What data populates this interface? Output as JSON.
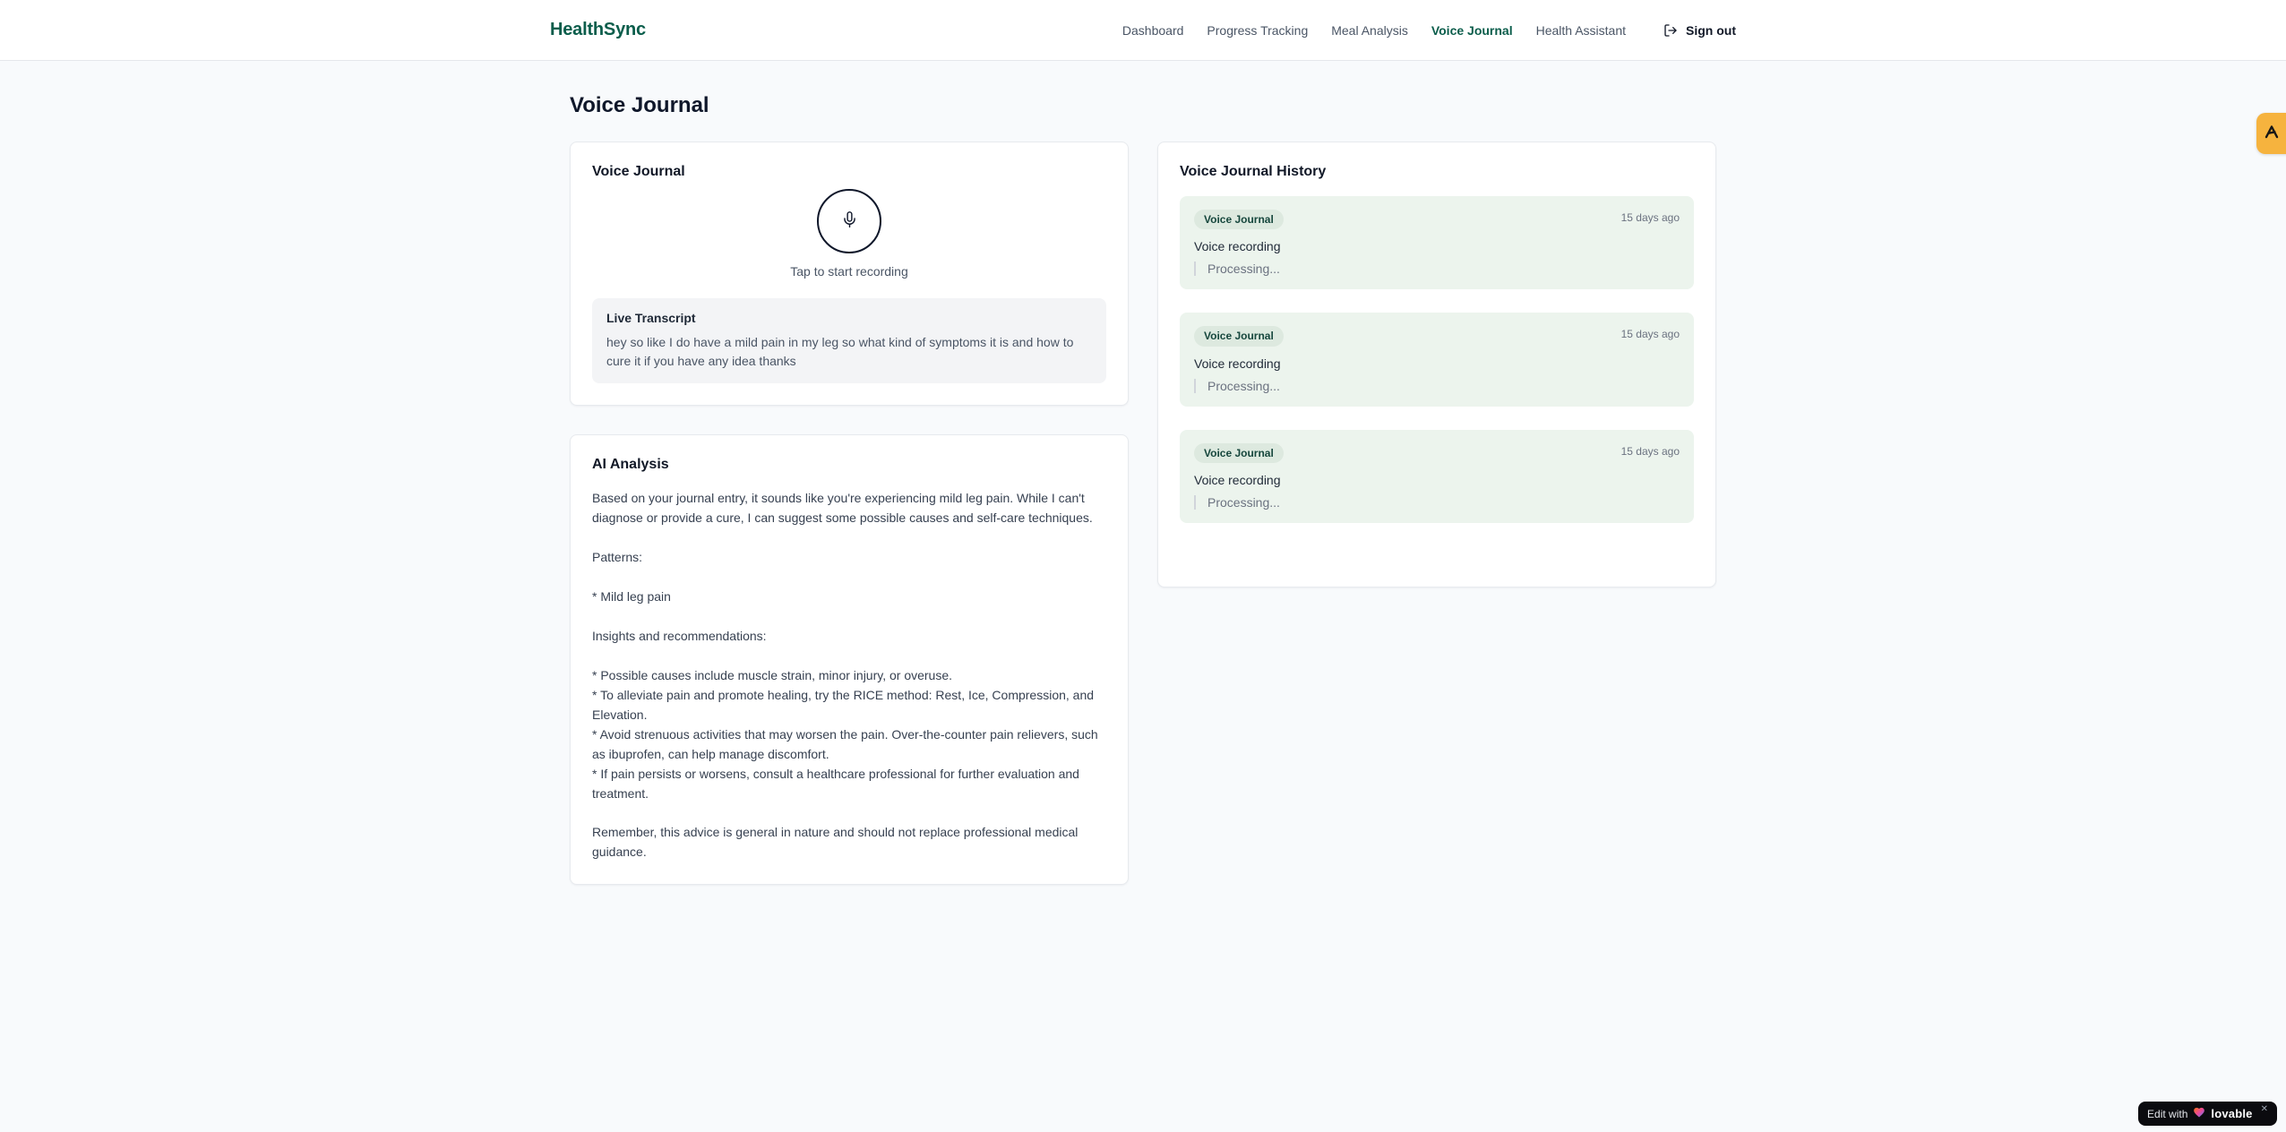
{
  "header": {
    "logo": "HealthSync",
    "nav": [
      {
        "label": "Dashboard",
        "active": false
      },
      {
        "label": "Progress Tracking",
        "active": false
      },
      {
        "label": "Meal Analysis",
        "active": false
      },
      {
        "label": "Voice Journal",
        "active": true
      },
      {
        "label": "Health Assistant",
        "active": false
      }
    ],
    "sign_out_label": "Sign out"
  },
  "page": {
    "title": "Voice Journal"
  },
  "recorder": {
    "title": "Voice Journal",
    "hint": "Tap to start recording",
    "transcript_title": "Live Transcript",
    "transcript_text": "hey so like I do have a mild pain in my leg so what kind of symptoms it is and how to cure it if you have any idea thanks"
  },
  "analysis": {
    "title": "AI Analysis",
    "body": "Based on your journal entry, it sounds like you're experiencing mild leg pain. While I can't diagnose or provide a cure, I can suggest some possible causes and self-care techniques.\n\nPatterns:\n\n* Mild leg pain\n\nInsights and recommendations:\n\n* Possible causes include muscle strain, minor injury, or overuse.\n* To alleviate pain and promote healing, try the RICE method: Rest, Ice, Compression, and Elevation.\n* Avoid strenuous activities that may worsen the pain. Over-the-counter pain relievers, such as ibuprofen, can help manage discomfort.\n* If pain persists or worsens, consult a healthcare professional for further evaluation and treatment.\n\nRemember, this advice is general in nature and should not replace professional medical guidance."
  },
  "history": {
    "title": "Voice Journal History",
    "entries": [
      {
        "badge": "Voice Journal",
        "time": "15 days ago",
        "text": "Voice recording",
        "status": "Processing..."
      },
      {
        "badge": "Voice Journal",
        "time": "15 days ago",
        "text": "Voice recording",
        "status": "Processing..."
      },
      {
        "badge": "Voice Journal",
        "time": "15 days ago",
        "text": "Voice recording",
        "status": "Processing..."
      }
    ]
  },
  "badges": {
    "edit_label": "Edit with",
    "brand": "lovable",
    "close": "✕"
  },
  "icons": {
    "sign_out": "logout-arrow-icon",
    "mic": "microphone-icon",
    "heart": "gradient-heart-icon",
    "edge": "lovable-mark-icon"
  },
  "colors": {
    "brand_green": "#0b5d4b",
    "page_background": "#f8fafc",
    "entry_green": "#ecf4ed",
    "badge_green": "#dde9df",
    "badge_text_green": "#16473d",
    "edge_badge_orange": "#f6b33e",
    "lovable_black": "#0b0b0f"
  }
}
